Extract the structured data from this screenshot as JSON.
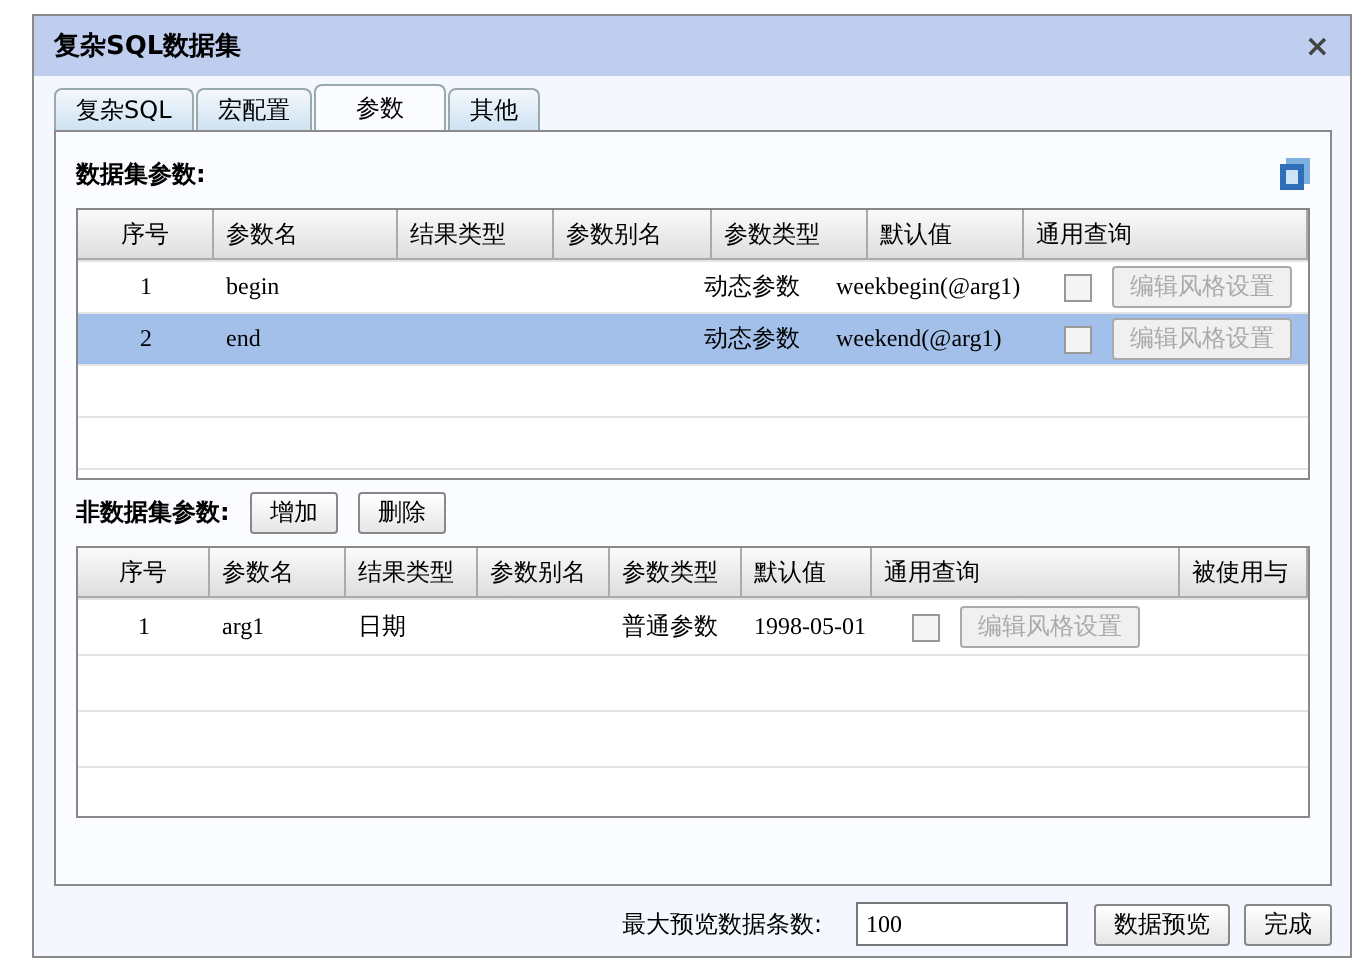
{
  "window": {
    "title": "复杂SQL数据集",
    "close": "×"
  },
  "tabs": [
    {
      "label": "复杂SQL",
      "selected": false
    },
    {
      "label": "宏配置",
      "selected": false
    },
    {
      "label": "参数",
      "selected": true
    },
    {
      "label": "其他",
      "selected": false
    }
  ],
  "dataset_params": {
    "title": "数据集参数:",
    "columns": [
      "序号",
      "参数名",
      "结果类型",
      "参数别名",
      "参数类型",
      "默认值",
      "通用查询"
    ],
    "rows": [
      {
        "index": "1",
        "name": "begin",
        "param_type": "动态参数",
        "default": "weekbegin(@arg1)",
        "checked": false,
        "button": {
          "label": "编辑风格设置",
          "disabled": true
        },
        "selected": false
      },
      {
        "index": "2",
        "name": "end",
        "param_type": "动态参数",
        "default": "weekend(@arg1)",
        "checked": false,
        "button": {
          "label": "编辑风格设置",
          "disabled": true
        },
        "selected": true
      }
    ]
  },
  "other_params": {
    "title": "非数据集参数:",
    "buttons": [
      "增加",
      "删除"
    ],
    "columns": [
      "序号",
      "参数名",
      "结果类型",
      "参数别名",
      "参数类型",
      "默认值",
      "通用查询",
      "被使用与"
    ],
    "rows": [
      {
        "index": "1",
        "name": "arg1",
        "result_type": "日期",
        "param_type": "普通参数",
        "default": "1998-05-01",
        "checked": false,
        "button": {
          "label": "编辑风格设置",
          "disabled": true
        }
      }
    ]
  },
  "footer": {
    "label": "最大预览数据条数:",
    "value": "100",
    "buttons": [
      "数据预览",
      "完成"
    ]
  }
}
